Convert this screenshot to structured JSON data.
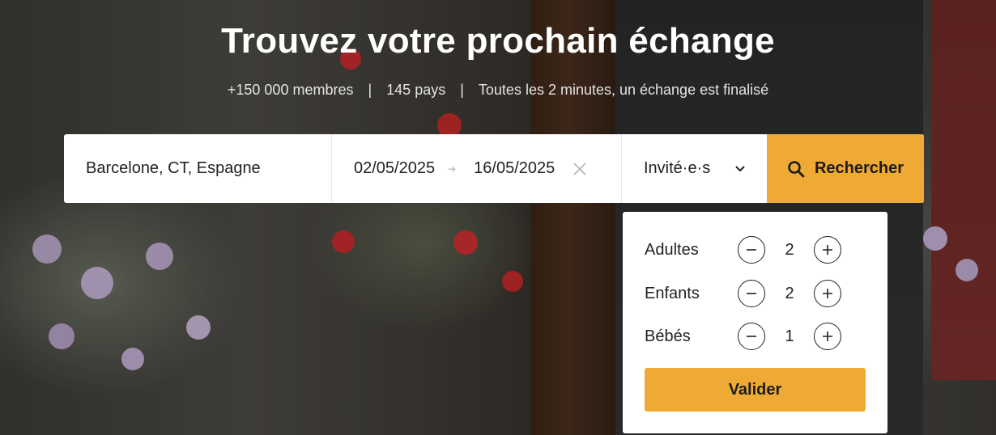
{
  "hero": {
    "title": "Trouvez votre prochain échange",
    "stats": [
      "+150 000 membres",
      "145 pays",
      "Toutes les 2 minutes, un échange est finalisé"
    ],
    "separator": "|"
  },
  "search": {
    "destination": "Barcelone, CT, Espagne",
    "date_start": "02/05/2025",
    "date_end": "16/05/2025",
    "guests_label": "Invité·e·s",
    "search_label": "Rechercher"
  },
  "guests_popup": {
    "rows": [
      {
        "label": "Adultes",
        "count": "2"
      },
      {
        "label": "Enfants",
        "count": "2"
      },
      {
        "label": "Bébés",
        "count": "1"
      }
    ],
    "validate_label": "Valider"
  },
  "colors": {
    "accent": "#efa935"
  }
}
